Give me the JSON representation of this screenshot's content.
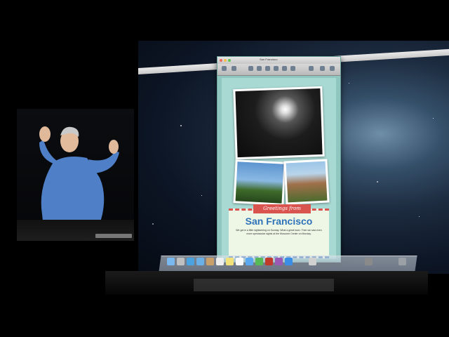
{
  "window": {
    "title": "San Francisco"
  },
  "document": {
    "greeting": "Greetings from",
    "headline": "San Francisco",
    "body": "We got in a little sightseeing on Sunday. What a great town. Then we saw even more spectacular sights at the Moscone Center on Monday."
  },
  "colors": {
    "accent_blue": "#2e73b8",
    "banner_red": "#d9534f",
    "page_bg": "#a8d9d3"
  },
  "dock": {
    "icons": [
      "finder-icon",
      "launchpad-icon",
      "safari-icon",
      "mail-icon",
      "contacts-icon",
      "calendar-icon",
      "notes-icon",
      "reminders-icon",
      "messages-icon",
      "facetime-icon",
      "photo-booth-icon",
      "itunes-icon",
      "app-store-icon",
      "preview-icon",
      "system-preferences-icon",
      "trash-icon"
    ]
  }
}
